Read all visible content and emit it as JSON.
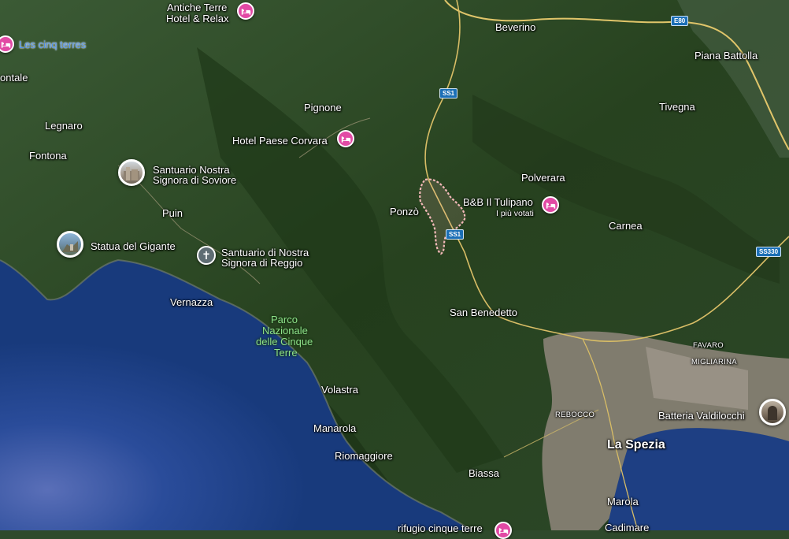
{
  "map": {
    "view": "satellite",
    "colors": {
      "sea": "#1c3f86",
      "land": "#2f4a2c",
      "forest": "#26401f",
      "city": "#9a8f86",
      "hotel_pin": "#e24aa5",
      "route_highlight": "#f2b8b8",
      "road": "#e0c56a",
      "road_badge": "#1b6fb6"
    }
  },
  "places": {
    "beverino": "Beverino",
    "piana_battolla": "Piana Battolla",
    "tivegna": "Tivegna",
    "pignone": "Pignone",
    "legnaro": "Legnaro",
    "fontona": "Fontona",
    "montale": "ontale",
    "puin": "Puin",
    "ponzo": "Ponzò",
    "polverara": "Polverara",
    "carnea": "Carnea",
    "vernazza": "Vernazza",
    "san_benedetto": "San Benedetto",
    "favaro": "FAVARO",
    "migliarina": "MIGLIARINA",
    "rebocco": "REBOCCO",
    "la_spezia": "La Spezia",
    "volastra": "Volastra",
    "manarola": "Manarola",
    "riomaggiore": "Riomaggiore",
    "biassa": "Biassa",
    "marola": "Marola",
    "cadimare": "Cadimare"
  },
  "park": {
    "line1": "Parco",
    "line2": "Nazionale",
    "line3": "delle Cinque",
    "line4": "Terre"
  },
  "pois": {
    "antiche_terre_line1": "Antiche Terre",
    "antiche_terre_line2": "Hotel & Relax",
    "cinq_terres": "Les cinq terres",
    "hotel_corvara": "Hotel Paese Corvara",
    "santuario_soviore_line1": "Santuario Nostra",
    "santuario_soviore_line2": "Signora di Soviore",
    "statua_gigante": "Statua del Gigante",
    "santuario_reggio_line1": "Santuario di Nostra",
    "santuario_reggio_line2": "Signora di Reggio",
    "bb_tulipano": "B&B Il Tulipano",
    "bb_tulipano_sub": "I più votati",
    "batteria": "Batteria Valdilocchi",
    "rifugio": "rifugio cinque terre"
  },
  "roads": {
    "e80": "E80",
    "ss1_north": "SS1",
    "ss1_south": "SS1",
    "ss330": "SS330"
  },
  "icons": {
    "hotel": "bed-icon",
    "church": "cross-icon",
    "photo": "photo-thumbnail-icon"
  }
}
